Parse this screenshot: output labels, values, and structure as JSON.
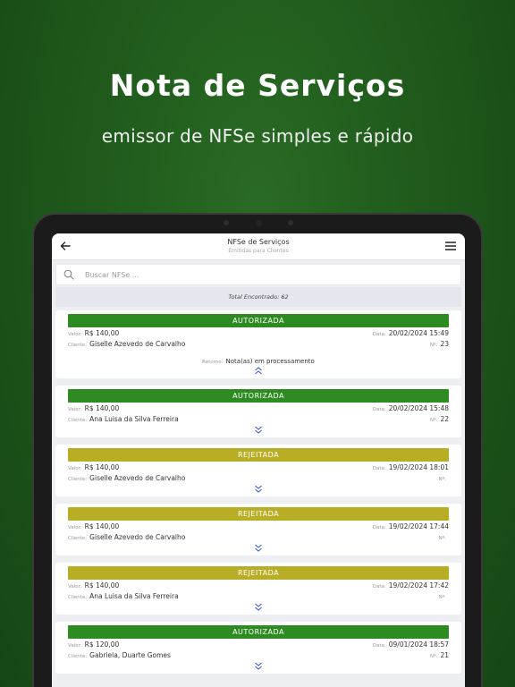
{
  "hero": {
    "title": "Nota de Serviços",
    "subtitle": "emissor de NFSe simples e rápido"
  },
  "colors": {
    "background": "#1f5a1c",
    "status_autorizada": "#2e8b22",
    "status_rejeitada": "#b8ae26",
    "chevron": "#3b5bdb"
  },
  "header": {
    "title": "NFSe de Serviços",
    "subtitle": "Emitidas para Clientes",
    "back_icon": "arrow-left-icon",
    "menu_icon": "hamburger-menu-icon"
  },
  "search": {
    "placeholder": "Buscar NFSe ...",
    "value": ""
  },
  "total": "Total Encontrado: 62",
  "labels": {
    "valor": "Valor:",
    "cliente": "Cliente:",
    "data": "Data:",
    "numero": "Nº:",
    "retorno": "Retorno:"
  },
  "notes": [
    {
      "status": "AUTORIZADA",
      "valor": "R$ 140,00",
      "cliente": "Giselle Azevedo de Carvalho",
      "data": "20/02/2024 15:49",
      "numero": "23",
      "retorno": "Nota(as) em processamento",
      "chevron": "chevron-up"
    },
    {
      "status": "AUTORIZADA",
      "valor": "R$ 140,00",
      "cliente": "Ana Luisa da Silva Ferreira",
      "data": "20/02/2024 15:48",
      "numero": "22",
      "chevron": "chevron-down"
    },
    {
      "status": "REJEITADA",
      "valor": "R$ 140,00",
      "cliente": "Giselle Azevedo de Carvalho",
      "data": "19/02/2024 18:01",
      "numero": "",
      "chevron": "chevron-down"
    },
    {
      "status": "REJEITADA",
      "valor": "R$ 140,00",
      "cliente": "Giselle Azevedo de Carvalho",
      "data": "19/02/2024 17:44",
      "numero": "",
      "chevron": "chevron-down"
    },
    {
      "status": "REJEITADA",
      "valor": "R$ 140,00",
      "cliente": "Ana Luisa da Silva Ferreira",
      "data": "19/02/2024 17:42",
      "numero": "",
      "chevron": "chevron-down"
    },
    {
      "status": "AUTORIZADA",
      "valor": "R$ 120,00",
      "cliente": "Gabriela, Duarte Gomes",
      "data": "09/01/2024 18:57",
      "numero": "21",
      "chevron": "chevron-down"
    }
  ]
}
